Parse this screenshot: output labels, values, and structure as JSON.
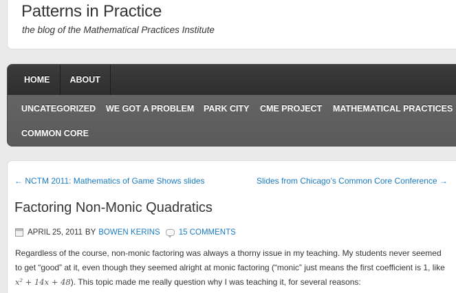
{
  "header": {
    "title": "Patterns in Practice",
    "tagline": "the blog of the Mathematical Practices Institute"
  },
  "nav": {
    "primary": [
      "HOME",
      "ABOUT"
    ],
    "categories": [
      "UNCATEGORIZED",
      "WE GOT A PROBLEM",
      "PARK CITY",
      "CME PROJECT",
      "MATHEMATICAL PRACTICES",
      "COMMON CORE"
    ]
  },
  "post_nav": {
    "prev": "← NCTM 2011: Mathematics of Game Shows slides",
    "next": "Slides from Chicago’s Common Core Conference →"
  },
  "post": {
    "title": "Factoring Non-Monic Quadratics",
    "date": "APRIL 25, 2011",
    "by": "BY",
    "author": "BOWEN KERINS",
    "comments": "15 COMMENTS",
    "line1": "Regardless of the course, non-monic factoring was always a thorny issue in my teaching.  My students never seemed",
    "line2": "to get “good” at it, even though they seemed alright at monic factoring (“monic” just means the first coefficient is 1, like",
    "math": "x² + 14x + 48",
    "line3_tail": ").  This topic made me really question why I was teaching it, for several reasons:"
  },
  "colors": {
    "link": "#1a7ac0",
    "nav_dark": "#333333",
    "nav_light": "#606060"
  }
}
